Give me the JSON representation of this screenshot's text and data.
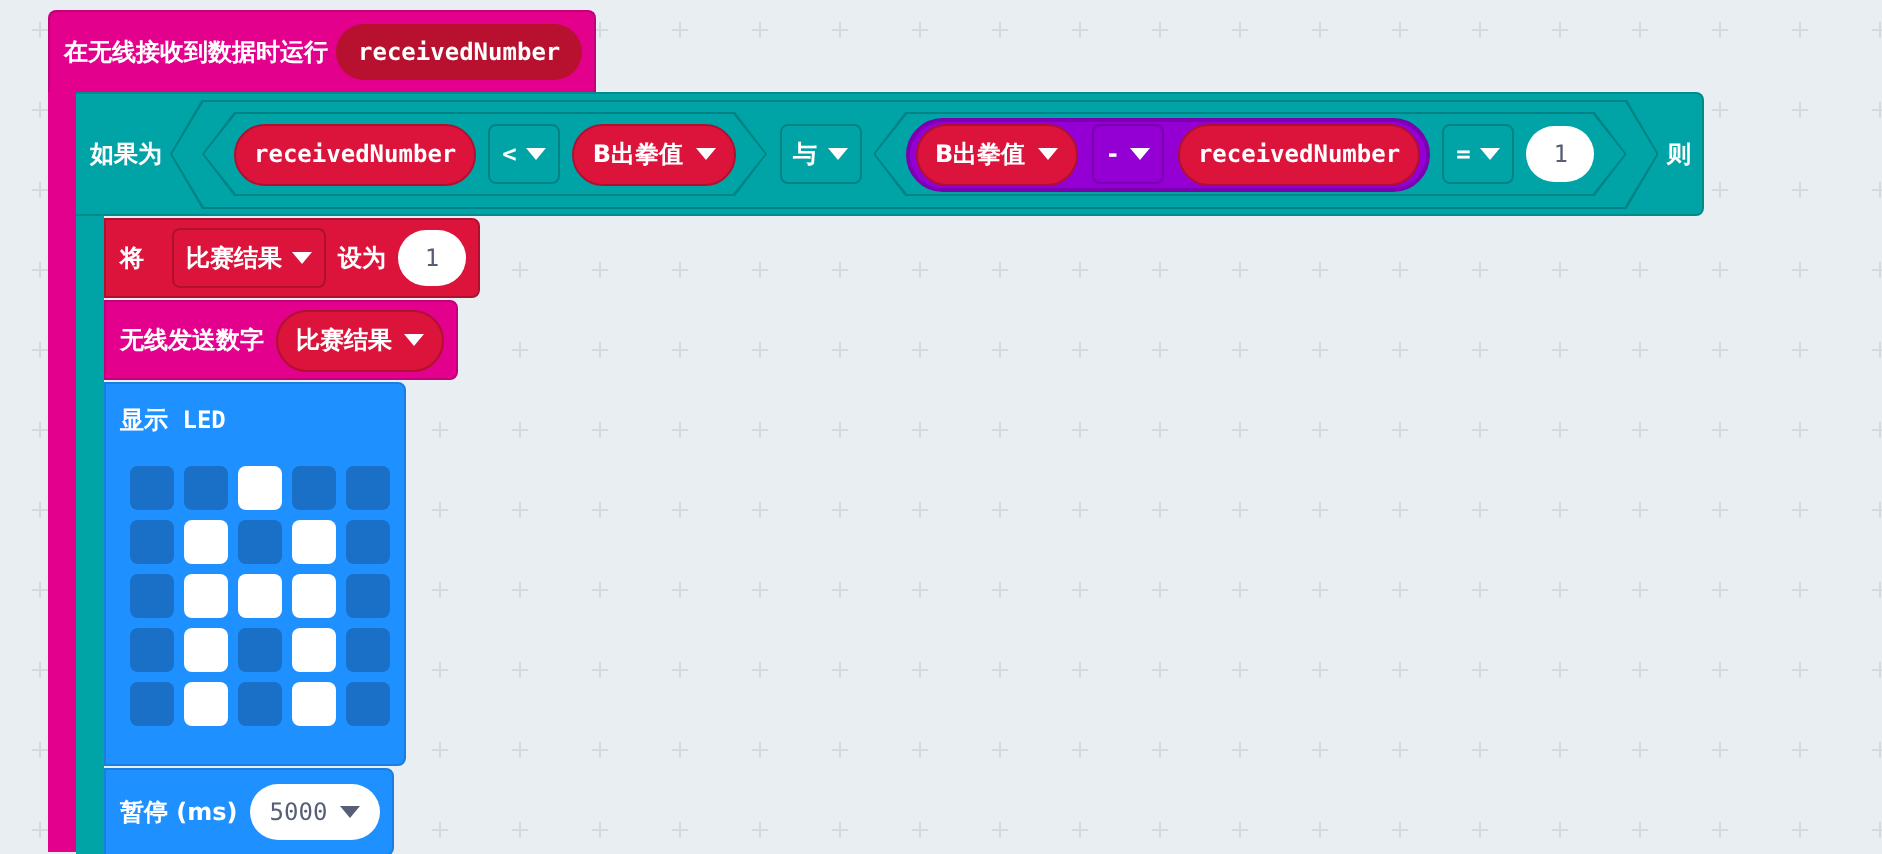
{
  "event_block": {
    "label": "在无线接收到数据时运行",
    "parameter": "receivedNumber",
    "if_block": {
      "label": "如果为",
      "then_label": "则",
      "condition": {
        "kind": "logic",
        "op": "与",
        "left": {
          "kind": "compare",
          "op": "<",
          "a": {
            "kind": "variable",
            "text": "receivedNumber",
            "dropdown": false
          },
          "b": {
            "kind": "variable",
            "text": "B出拳值",
            "dropdown": true
          }
        },
        "right": {
          "kind": "compare",
          "op": "=",
          "a": {
            "kind": "math",
            "op": "-",
            "a": {
              "kind": "variable",
              "text": "B出拳值",
              "dropdown": true
            },
            "b": {
              "kind": "variable",
              "text": "receivedNumber",
              "dropdown": false
            }
          },
          "b": {
            "kind": "number",
            "text": "1"
          }
        }
      },
      "statements": [
        {
          "kind": "set",
          "label": "将",
          "variable": "比赛结果",
          "to_label": "设为",
          "value": "1"
        },
        {
          "kind": "radio_send",
          "label": "无线发送数字",
          "variable": "比赛结果"
        },
        {
          "kind": "show_leds",
          "label": "显示 LED",
          "leds": [
            [
              false,
              false,
              true,
              false,
              false
            ],
            [
              false,
              true,
              false,
              true,
              false
            ],
            [
              false,
              true,
              true,
              true,
              false
            ],
            [
              false,
              true,
              false,
              true,
              false
            ],
            [
              false,
              true,
              false,
              true,
              false
            ]
          ]
        },
        {
          "kind": "pause",
          "label": "暂停 (ms)",
          "value": "5000"
        }
      ]
    }
  }
}
